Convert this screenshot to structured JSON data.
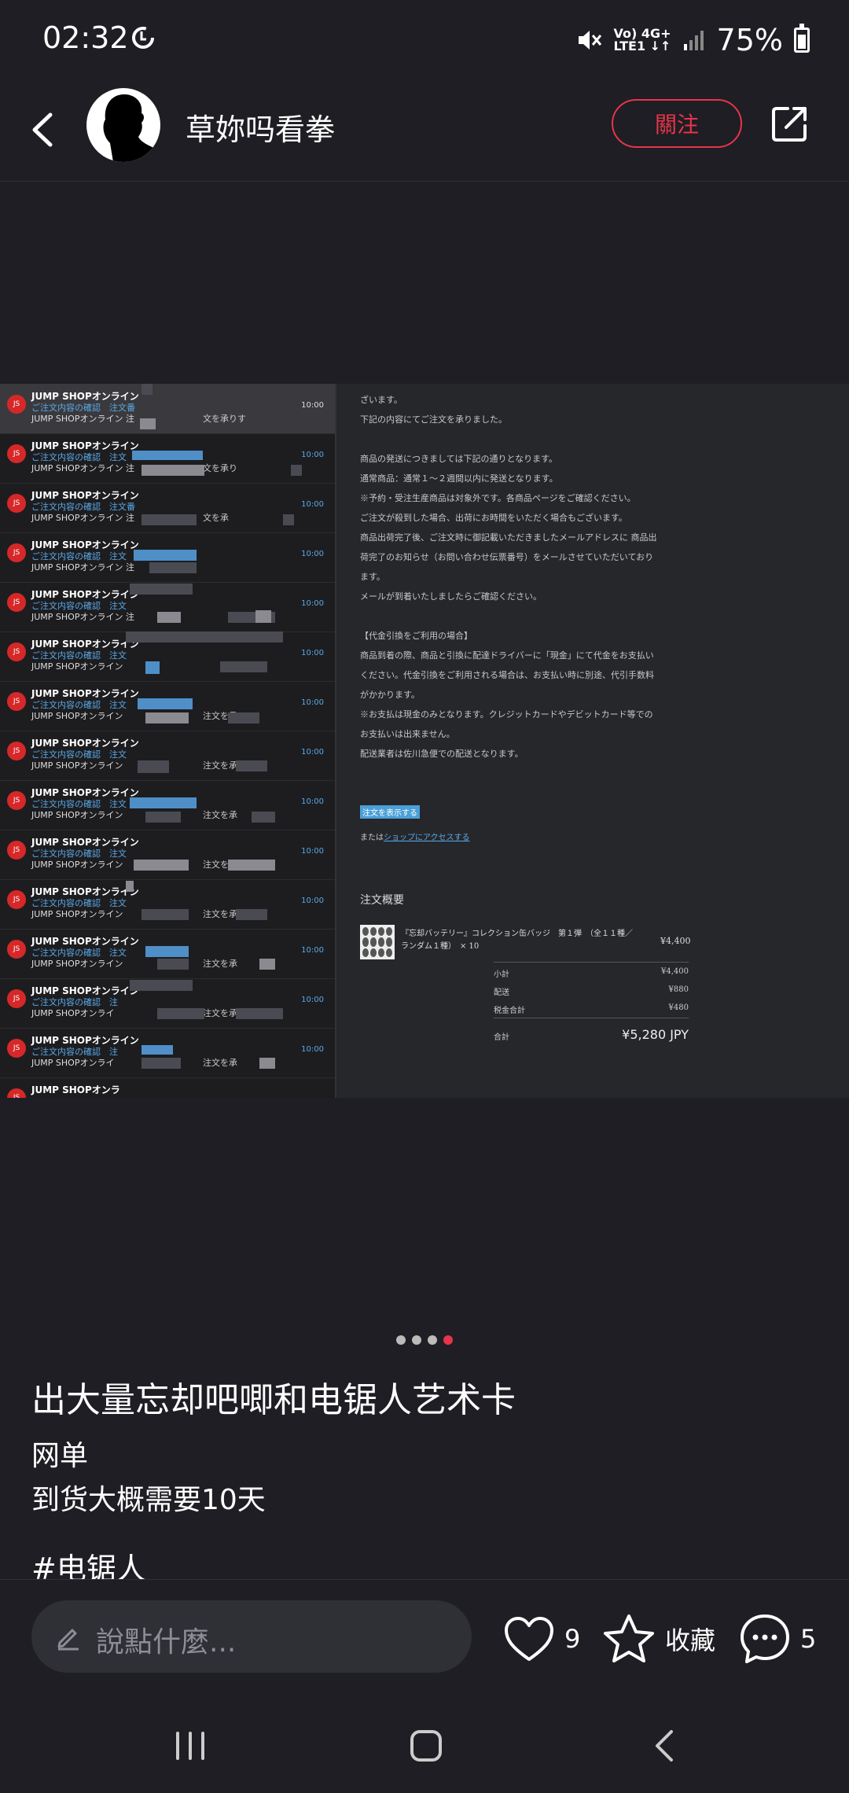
{
  "status_bar": {
    "time": "02:32",
    "network_line1": "Vo) 4G+",
    "network_line2": "LTE1 ↓↑",
    "battery": "75%",
    "battery_level": 0.75
  },
  "header": {
    "author_name": "草妳吗看拳",
    "follow_label": "關注"
  },
  "image": {
    "pager": {
      "total": 4,
      "active_index": 3
    },
    "mail_list": {
      "items": [
        {
          "sender": "JUMP SHOPオンライン",
          "subject": "ご注文内容の確認　注文番",
          "preview": "JUMP SHOPオンライン 注",
          "snippet": "文を承りす",
          "time": "10:00"
        },
        {
          "sender": "JUMP SHOPオンライン",
          "subject": "ご注文内容の確認　注文",
          "preview": "JUMP SHOPオンライン 注",
          "snippet": "文を承り",
          "time": "10:00"
        },
        {
          "sender": "JUMP SHOPオンライン",
          "subject": "ご注文内容の確認　注文番",
          "preview": "JUMP SHOPオンライン 注",
          "snippet": "文を承",
          "time": "10:00"
        },
        {
          "sender": "JUMP SHOPオンライン",
          "subject": "ご注文内容の確認　注文",
          "preview": "JUMP SHOPオンライン 注",
          "snippet": "",
          "time": "10:00"
        },
        {
          "sender": "JUMP SHOPオンライン",
          "subject": "ご注文内容の確認　注文",
          "preview": "JUMP SHOPオンライン 注",
          "snippet": "",
          "time": "10:00"
        },
        {
          "sender": "JUMP SHOPオンライン",
          "subject": "ご注文内容の確認　注文",
          "preview": "JUMP SHOPオンライン",
          "snippet": "",
          "time": "10:00"
        },
        {
          "sender": "JUMP SHOPオンライン",
          "subject": "ご注文内容の確認　注文",
          "preview": "JUMP SHOPオンライン",
          "snippet": "注文を承",
          "time": "10:00"
        },
        {
          "sender": "JUMP SHOPオンライン",
          "subject": "ご注文内容の確認　注文",
          "preview": "JUMP SHOPオンライン",
          "snippet": "注文を承",
          "time": "10:00"
        },
        {
          "sender": "JUMP SHOPオンライン",
          "subject": "ご注文内容の確認　注文",
          "preview": "JUMP SHOPオンライン",
          "snippet": "注文を承",
          "time": "10:00"
        },
        {
          "sender": "JUMP SHOPオンライン",
          "subject": "ご注文内容の確認　注文",
          "preview": "JUMP SHOPオンライン",
          "snippet": "注文を承",
          "time": "10:00"
        },
        {
          "sender": "JUMP SHOPオンライン",
          "subject": "ご注文内容の確認　注文",
          "preview": "JUMP SHOPオンライン",
          "snippet": "注文を承",
          "time": "10:00"
        },
        {
          "sender": "JUMP SHOPオンライン",
          "subject": "ご注文内容の確認　注文",
          "preview": "JUMP SHOPオンライン",
          "snippet": "注文を承",
          "time": "10:00"
        },
        {
          "sender": "JUMP SHOPオンライン",
          "subject": "ご注文内容の確認　注",
          "preview": "JUMP SHOPオンライ",
          "snippet": "注文を承",
          "time": "10:00"
        },
        {
          "sender": "JUMP SHOPオンライン",
          "subject": "ご注文内容の確認　注",
          "preview": "JUMP SHOPオンライ",
          "snippet": "注文を承",
          "time": "10:00"
        },
        {
          "sender": "JUMP SHOPオンラ",
          "subject": "",
          "preview": "",
          "snippet": "",
          "time": ""
        }
      ]
    },
    "mail_body": {
      "lines": [
        "ざいます。",
        "下記の内容にてご注文を承りました。",
        "",
        "商品の発送につきましては下記の通りとなります。",
        "通常商品：通常１～２週間以内に発送となります。",
        "※予約・受注生産商品は対象外です。各商品ページをご確認ください。",
        "ご注文が殺到した場合、出荷にお時間をいただく場合もございます。",
        "商品出荷完了後、ご注文時に御記載いただきましたメールアドレスに 商品出",
        "荷完了のお知らせ（お問い合わせ伝票番号）をメールさせていただいており",
        "ます。",
        "メールが到着いたしましたらご確認ください。",
        "",
        "【代金引換をご利用の場合】",
        "商品到着の際、商品と引換に配達ドライバーに「現金」にて代金をお支払い",
        "ください。代金引換をご利用される場合は、お支払い時に別途、代引手数料",
        "がかかります。",
        "※お支払は現金のみとなります。クレジットカードやデビットカード等での",
        "お支払いは出来ません。",
        "配送業者は佐川急便での配送となります。"
      ],
      "view_order_button": "注文を表示する",
      "or_text": "または",
      "shop_link": "ショップにアクセスする",
      "summary_title": "注文概要",
      "item_name": "『忘却バッテリー』コレクション缶バッジ　第１弾　（全１１種／ランダム１種）　× 10",
      "item_price": "¥4,400",
      "subtotal_label": "小計",
      "subtotal_value": "¥4,400",
      "shipping_label": "配送",
      "shipping_value": "¥880",
      "tax_label": "税金合計",
      "tax_value": "¥480",
      "total_label": "合計",
      "total_value": "¥5,280 JPY"
    }
  },
  "post": {
    "title": "出大量忘却吧唧和电锯人艺术卡",
    "lines": [
      "网单",
      "到货大概需要10天"
    ],
    "tag": "#电锯人"
  },
  "action_bar": {
    "comment_placeholder": "說點什麼...",
    "like_count": "9",
    "collect_label": "收藏",
    "comment_count": "5"
  },
  "colors": {
    "background": "#1e1e24",
    "accent": "#e8344a",
    "link": "#5aa9e6"
  }
}
